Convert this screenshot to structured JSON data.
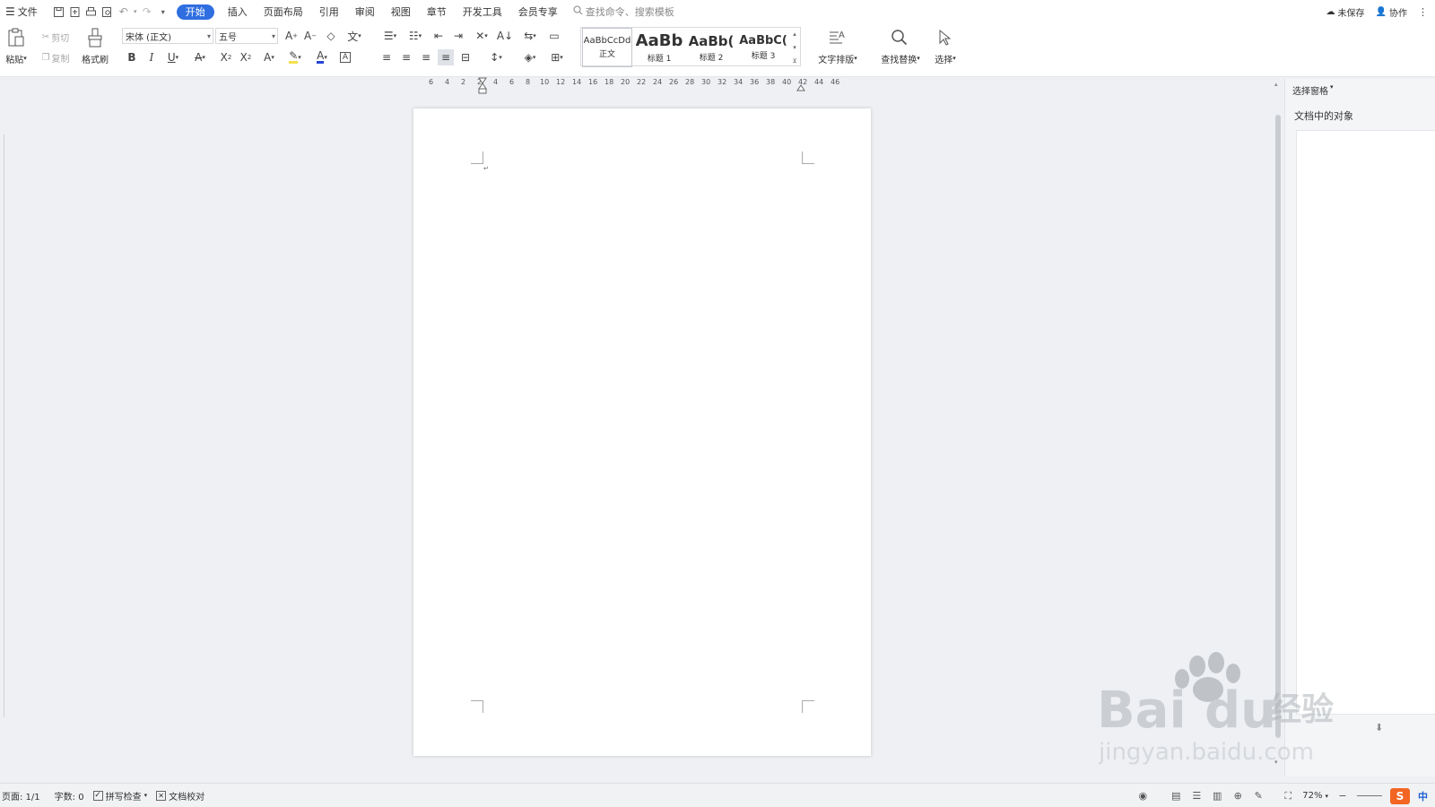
{
  "menu": {
    "file_label": "文件",
    "tabs": [
      {
        "label": "开始",
        "active": true
      },
      {
        "label": "插入"
      },
      {
        "label": "页面布局"
      },
      {
        "label": "引用"
      },
      {
        "label": "审阅"
      },
      {
        "label": "视图"
      },
      {
        "label": "章节"
      },
      {
        "label": "开发工具"
      },
      {
        "label": "会员专享"
      }
    ],
    "search_placeholder": "查找命令、搜索模板",
    "unsaved_label": "未保存",
    "collab_label": "协作"
  },
  "ribbon": {
    "paste_label": "粘贴",
    "cut_label": "剪切",
    "copy_label": "复制",
    "format_painter_label": "格式刷",
    "font_name": "宋体 (正文)",
    "font_size": "五号",
    "styles": [
      {
        "preview": "AaBbCcDd",
        "label": "正文"
      },
      {
        "preview": "AaBb",
        "label": "标题 1"
      },
      {
        "preview": "AaBb(",
        "label": "标题 2"
      },
      {
        "preview": "AaBbC(",
        "label": "标题 3"
      }
    ],
    "text_layout_label": "文字排版",
    "find_replace_label": "查找替换",
    "select_label": "选择"
  },
  "ruler": {
    "ticks": [
      "6",
      "4",
      "2",
      "2",
      "4",
      "6",
      "8",
      "10",
      "12",
      "14",
      "16",
      "18",
      "20",
      "22",
      "24",
      "26",
      "28",
      "30",
      "32",
      "34",
      "36",
      "38",
      "40",
      "42",
      "44",
      "46"
    ]
  },
  "side_panel": {
    "title": "选择窗格",
    "subtitle": "文档中的对象"
  },
  "status": {
    "page": "页面: 1/1",
    "word_count": "字数: 0",
    "spell_check": "拼写检查",
    "doc_check": "文档校对",
    "zoom": "72%",
    "ime": "中"
  },
  "watermark": {
    "brand": "Bai",
    "brand2": "du",
    "brand_cn": "经验",
    "url": "jingyan.baidu.com"
  },
  "colors": {
    "accent": "#2f6ee0",
    "page_bg": "#eef0f3",
    "font_color_underline": "#2546d8",
    "highlight_underline": "#f4e04d"
  }
}
